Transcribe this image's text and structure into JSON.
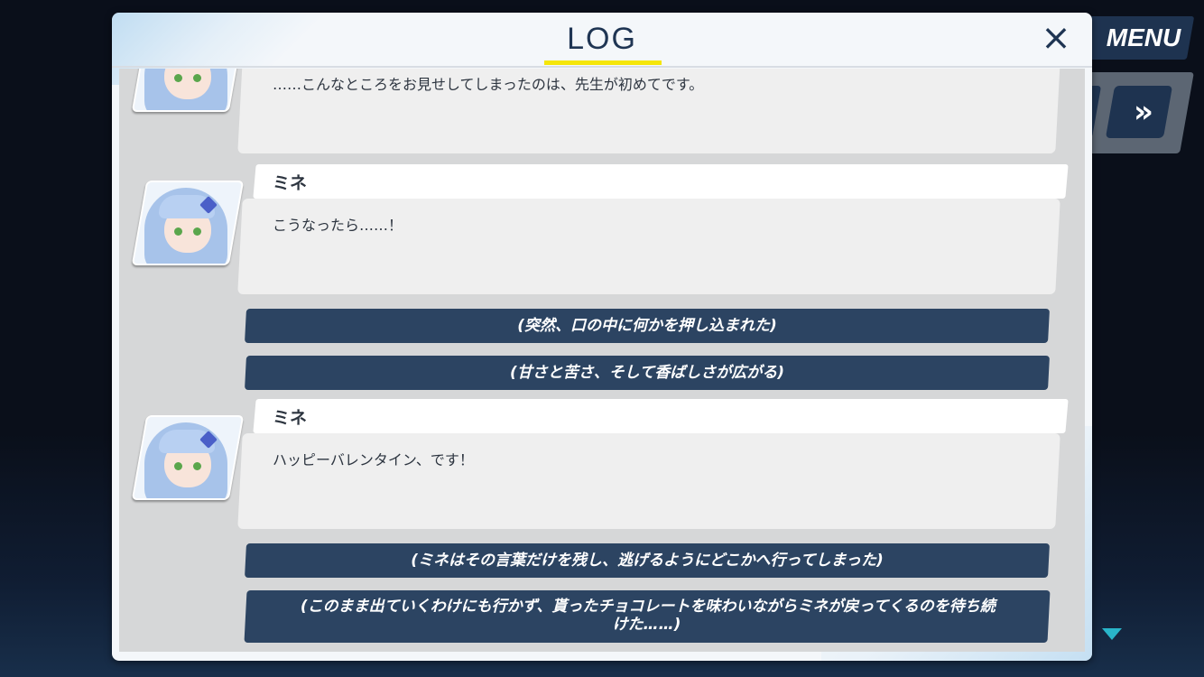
{
  "hud": {
    "menu_label": "MENU",
    "fast_forward_label": "»"
  },
  "log_panel": {
    "title": "LOG",
    "close_label": "×",
    "entries": [
      {
        "type": "dialogue",
        "speaker": "",
        "text": "……こんなところをお見せしてしまったのは、先生が初めてです。"
      },
      {
        "type": "dialogue",
        "speaker": "ミネ",
        "text": "こうなったら……！"
      },
      {
        "type": "narration",
        "text": "(突然、口の中に何かを押し込まれた)"
      },
      {
        "type": "narration",
        "text": "(甘さと苦さ、そして香ばしさが広がる)"
      },
      {
        "type": "dialogue",
        "speaker": "ミネ",
        "text": "ハッピーバレンタイン、です！"
      },
      {
        "type": "narration",
        "text": "(ミネはその言葉だけを残し、逃げるようにどこかへ行ってしまった)"
      },
      {
        "type": "narration",
        "text_line1": "(このまま出ていくわけにも行かず、貰ったチョコレートを味わいながらミネが戻ってくるのを待ち続",
        "text_line2": "けた……)"
      }
    ]
  },
  "colors": {
    "panel_bg": "#f4f7fa",
    "log_bg": "#d6d7d8",
    "narration_bg": "#2c4462",
    "title_color": "#1f3553",
    "title_underline": "#f5e60a",
    "menu_bg": "#1e3350",
    "scroll_arrow": "#29b5c9"
  }
}
